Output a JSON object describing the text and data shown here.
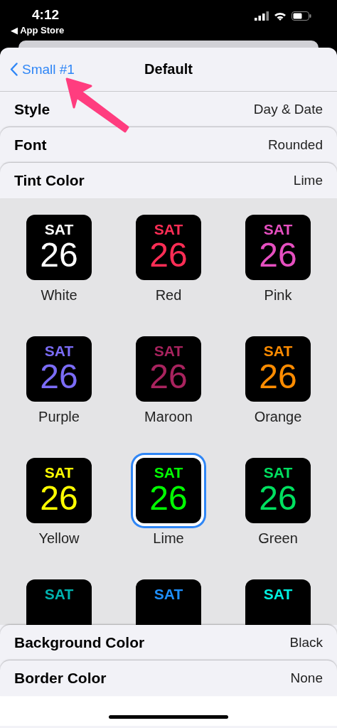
{
  "status_bar": {
    "time": "4:12",
    "back_app": "◀ App Store"
  },
  "nav": {
    "back": "Small #1",
    "title": "Default"
  },
  "settings": [
    {
      "label": "Style",
      "value": "Day & Date"
    },
    {
      "label": "Font",
      "value": "Rounded"
    },
    {
      "label": "Tint Color",
      "value": "Lime"
    }
  ],
  "tints": [
    {
      "day": "SAT",
      "date": "26",
      "label": "White",
      "color": "#ffffff",
      "selected": false
    },
    {
      "day": "SAT",
      "date": "26",
      "label": "Red",
      "color": "#ff2d55",
      "selected": false
    },
    {
      "day": "SAT",
      "date": "26",
      "label": "Pink",
      "color": "#e64fc0",
      "selected": false
    },
    {
      "day": "SAT",
      "date": "26",
      "label": "Purple",
      "color": "#7b6cf6",
      "selected": false
    },
    {
      "day": "SAT",
      "date": "26",
      "label": "Maroon",
      "color": "#a8235e",
      "selected": false
    },
    {
      "day": "SAT",
      "date": "26",
      "label": "Orange",
      "color": "#ff8c00",
      "selected": false
    },
    {
      "day": "SAT",
      "date": "26",
      "label": "Yellow",
      "color": "#ffff00",
      "selected": false
    },
    {
      "day": "SAT",
      "date": "26",
      "label": "Lime",
      "color": "#00ff00",
      "selected": true
    },
    {
      "day": "SAT",
      "date": "26",
      "label": "Green",
      "color": "#00e060",
      "selected": false
    },
    {
      "day": "SAT",
      "color": "#00b4b0",
      "selected": false
    },
    {
      "day": "SAT",
      "color": "#1e90ff",
      "selected": false
    },
    {
      "day": "SAT",
      "color": "#00f0e0",
      "selected": false
    }
  ],
  "bottom_settings": [
    {
      "label": "Background Color",
      "value": "Black"
    },
    {
      "label": "Border Color",
      "value": "None"
    }
  ]
}
